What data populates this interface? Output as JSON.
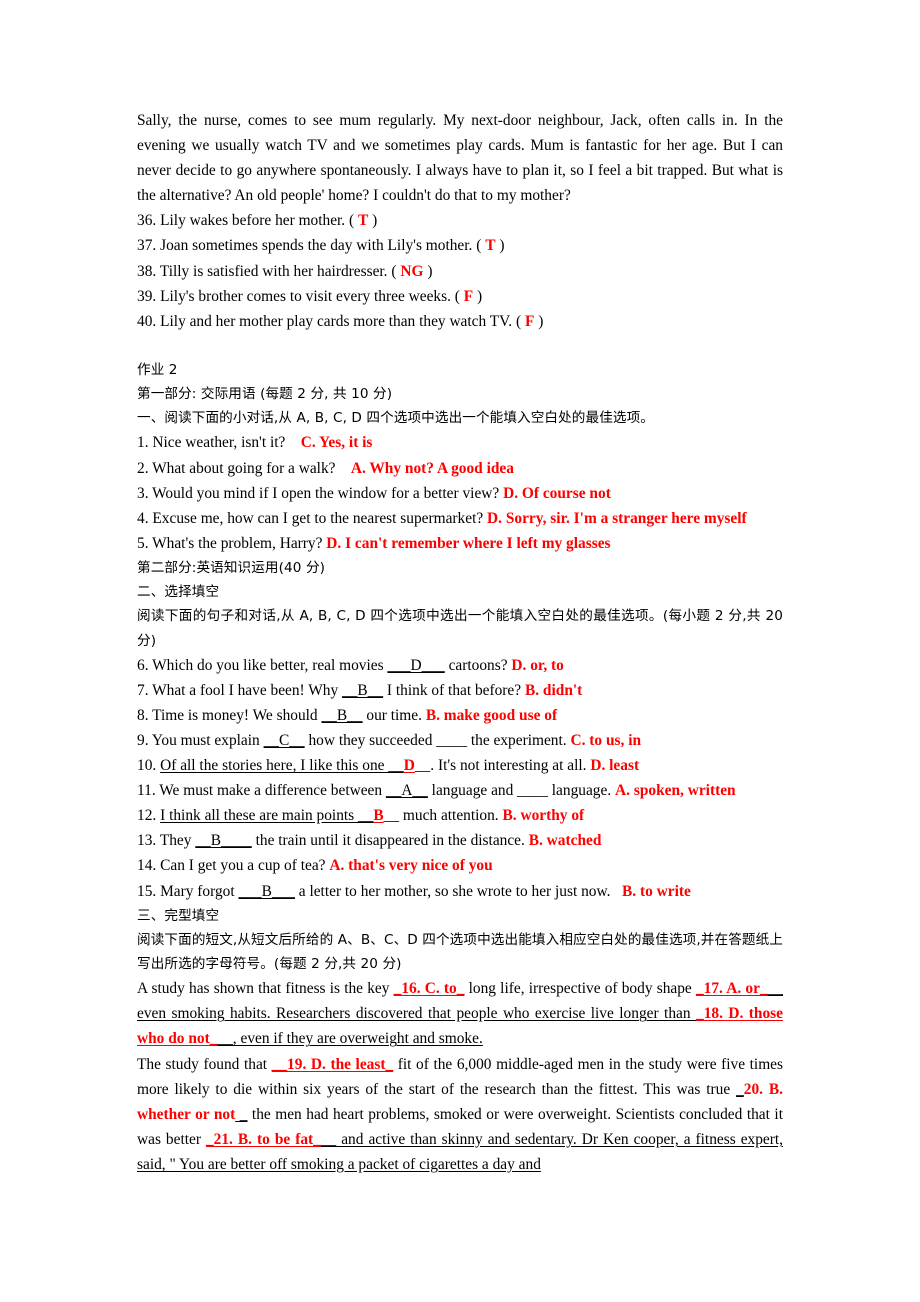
{
  "document": {
    "colors": {
      "answer_red": "#FF0000",
      "body_text": "#000000",
      "page_background": "#FFFFFF"
    },
    "reading_passage": {
      "lines": [
        "Sally, the nurse, comes to see mum regularly. My next-door neighbour, Jack, often calls in. In the evening we usually watch TV and we sometimes play cards. Mum is fantastic for her age. But I can never decide to go anywhere spontaneously. I always have to plan it, so I feel a bit trapped. But what is the alternative? An old people' home? I couldn't do that to my mother?"
      ]
    },
    "true_false_questions": [
      {
        "number": "36.",
        "text": "Lily wakes before her mother. (",
        "answer": "T",
        "close": ")"
      },
      {
        "number": "37.",
        "text": "Joan sometimes spends the day with Lily's mother. (",
        "answer": "T",
        "close": ")"
      },
      {
        "number": "38.",
        "text": "Tilly is satisfied with her hairdresser. (",
        "answer": "NG",
        "close": ")"
      },
      {
        "number": "39.",
        "text": "Lily's brother comes to visit every three weeks. (",
        "answer": "F",
        "close": ")"
      },
      {
        "number": "40.",
        "text": "Lily and her mother play cards more than they watch TV. (",
        "answer": "F",
        "close": ")"
      }
    ],
    "assignment_title": "作业 2",
    "part_one": {
      "heading": "第一部分: 交际用语 (每题 2 分, 共 10 分)",
      "instruction": "一、阅读下面的小对话,从 A, B, C, D 四个选项中选出一个能填入空白处的最佳选项。",
      "questions": [
        {
          "number": "1.",
          "prompt": "Nice weather, isn't it?",
          "answer": "C.  Yes, it is"
        },
        {
          "number": "2.",
          "prompt": "What about going for a walk?",
          "answer": "A.  Why not? A good idea"
        },
        {
          "number": "3.",
          "prompt": "Would you mind if I open the window for a better view?",
          "answer": "D. Of course not"
        },
        {
          "number": "4.",
          "prompt": "Excuse me, how can I get to the nearest supermarket?",
          "answer": "D. Sorry, sir. I'm a stranger here myself"
        },
        {
          "number": "5.",
          "prompt": "What's the problem, Harry?",
          "answer": "D. I can't remember where I left my glasses"
        }
      ]
    },
    "part_two": {
      "heading": "第二部分:英语知识运用(40 分)",
      "section_two": {
        "heading": "二、选择填空",
        "instruction": "阅读下面的句子和对话,从 A, B, C, D 四个选项中选出一个能填入空白处的最佳选项。(每小题 2 分,共 20 分)",
        "questions": [
          {
            "number": "6.",
            "before": "Which do you like better, real movies ",
            "blank": "___D___",
            "blank_red": false,
            "after": " cartoons?",
            "answer": "D. or, to"
          },
          {
            "number": "7.",
            "before": "What a fool I have been! Why ",
            "blank": "__B__",
            "blank_red": false,
            "after": " I think of that before?",
            "answer": "B. didn't"
          },
          {
            "number": "8.",
            "before": "Time is money! We should ",
            "blank": "__B__",
            "blank_red": false,
            "after": " our time.",
            "answer": "B. make good use of"
          },
          {
            "number": "9.",
            "before": "You must explain ",
            "blank": "__C__",
            "blank_red": false,
            "after": " how they succeeded ____ the experiment.",
            "answer": "C. to us, in"
          },
          {
            "number": "10.",
            "before": "Of all the stories here, I like this one __",
            "blank": "D",
            "blank_red": true,
            "after": "__. It's not interesting at all.",
            "answer": "D. least"
          },
          {
            "number": "11.",
            "before": "We must make a difference between ",
            "blank": "__A__",
            "blank_red": false,
            "after": " language and ____ language.",
            "answer": "A. spoken, written"
          },
          {
            "number": "12.",
            "before": "I think all these are main points __",
            "blank": "B",
            "blank_red": true,
            "after": "__ much attention.",
            "answer": "B. worthy of"
          },
          {
            "number": "13.",
            "before": "They ",
            "blank": "__B____",
            "blank_red": false,
            "after": " the train until it disappeared in the distance.",
            "answer": "B. watched"
          },
          {
            "number": "14.",
            "before": "Can I get you a cup of tea?",
            "blank": "",
            "blank_red": false,
            "after": "",
            "answer": "A. that's very nice of you"
          },
          {
            "number": "15.",
            "before": "Mary forgot ",
            "blank": "___B___",
            "blank_red": false,
            "after": " a letter to her mother, so she wrote to her just now.",
            "answer": "B. to write"
          }
        ]
      },
      "section_three": {
        "heading": "三、完型填空",
        "instruction": "阅读下面的短文,从短文后所给的 A、B、C、D 四个选项中选出能填入相应空白处的最佳选项,并在答题纸上写出所选的字母符号。(每题 2 分,共 20 分)",
        "cloze_paragraph_1": {
          "t1": "A study has shown that fitness is the key ",
          "a16": "_16. C. to_",
          "t2": " long life, irrespective of body shape ",
          "a17": "_17. A. or_",
          "t3": "__ even smoking habits. Researchers discovered that people who exercise live longer than ",
          "a18": "_18. D. those who do not_",
          "t4": "__, even if they are overweight and smoke."
        },
        "cloze_paragraph_2": {
          "t1": "The study found that ",
          "a19": "__19. D. the least_",
          "t2": " fit of the 6,000 middle-aged men in the study were five times more likely to die within six years of the start of the research than the fittest. This was true ",
          "a20": "20. B. whether or not",
          "t3": " the men had heart problems, smoked or were overweight. Scientists concluded that it was better ",
          "a21": "_21. B. to be fat_",
          "t4": "__ and active than skinny and sedentary. Dr Ken cooper, a fitness expert, said, \" You are better off smoking a packet of cigarettes a day and"
        }
      }
    }
  }
}
